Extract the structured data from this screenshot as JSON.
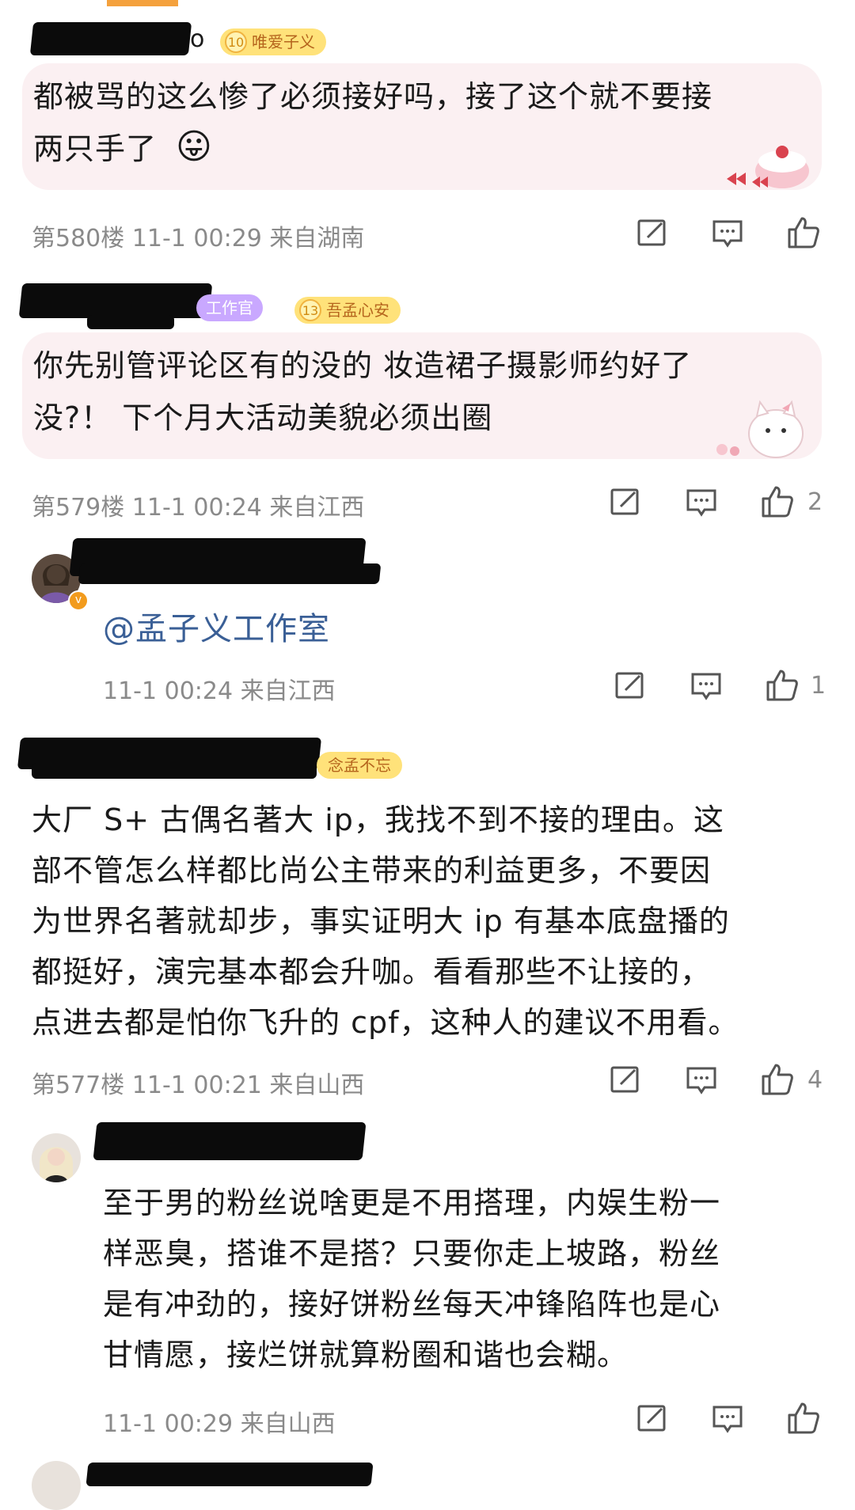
{
  "comments": [
    {
      "badge_level": "10",
      "badge_name": "唯爱子义",
      "username_suffix": "o",
      "lines": [
        "都被骂的这么惨了必须接好吗，接了这个就不要接",
        "两只手了"
      ],
      "emoji": "😛",
      "meta": "第580楼 11-1 00:29 来自湖南"
    },
    {
      "title_badge": "工作官",
      "badge_level": "13",
      "badge_name": "吾孟心安",
      "lines": [
        "你先别管评论区有的没的 妆造裙子摄影师约好了",
        "没?！ 下个月大活动美貌必须出圈"
      ],
      "meta": "第579楼 11-1 00:24 来自江西",
      "likes": "2"
    },
    {
      "reply": true,
      "mention": "@孟子义工作室",
      "meta": "11-1 00:24 来自江西",
      "likes": "1"
    },
    {
      "badge_name": "念孟不忘",
      "lines": [
        "大厂 S+ 古偶名著大 ip，我找不到不接的理由。这",
        "部不管怎么样都比尚公主带来的利益更多，不要因",
        "为世界名著就却步，事实证明大 ip 有基本底盘播的",
        "都挺好，演完基本都会升咖。看看那些不让接的，",
        "点进去都是怕你飞升的 cpf，这种人的建议不用看。"
      ],
      "meta": "第577楼 11-1 00:21 来自山西",
      "likes": "4"
    },
    {
      "reply": true,
      "lines": [
        "至于男的粉丝说啥更是不用搭理，内娱生粉一",
        "样恶臭，搭谁不是搭？只要你走上坡路，粉丝",
        "是有冲劲的，接好饼粉丝每天冲锋陷阵也是心",
        "甘情愿，接烂饼就算粉圈和谐也会糊。"
      ],
      "meta": "11-1 00:29 来自山西"
    }
  ],
  "icons": [
    "edit-icon",
    "comment-icon",
    "like-icon"
  ],
  "colors": {
    "bubble": "#fbf0f2",
    "mention": "#3a5f96",
    "badge": "#ffe27a",
    "meta": "#8a8a8a"
  }
}
